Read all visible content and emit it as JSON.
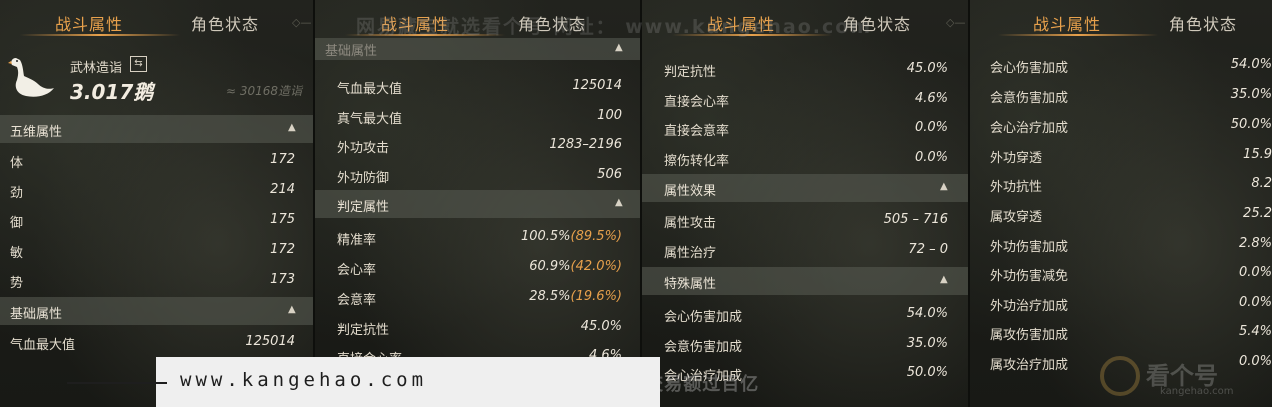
{
  "tabs": {
    "combat": "战斗属性",
    "status": "角色状态"
  },
  "panel1": {
    "character": {
      "name": "武林造诣",
      "value": "3.017鹅",
      "approx": "≈ 30168造诣"
    },
    "five_dim": {
      "title": "五维属性",
      "rows": [
        {
          "label": "体",
          "value": "172"
        },
        {
          "label": "劲",
          "value": "214"
        },
        {
          "label": "御",
          "value": "175"
        },
        {
          "label": "敏",
          "value": "172"
        },
        {
          "label": "势",
          "value": "173"
        }
      ]
    },
    "basic": {
      "title": "基础属性",
      "rows": [
        {
          "label": "气血最大值",
          "value": "125014"
        }
      ]
    }
  },
  "panel2": {
    "top_header_partial": "基础属性",
    "basic_rows": [
      {
        "label": "气血最大值",
        "value": "125014"
      },
      {
        "label": "真气最大值",
        "value": "100"
      },
      {
        "label": "外功攻击",
        "value": "1283–2196"
      },
      {
        "label": "外功防御",
        "value": "506"
      }
    ],
    "judge": {
      "title": "判定属性",
      "rows": [
        {
          "label": "精准率",
          "value": "100.5%",
          "paren": "(89.5%)"
        },
        {
          "label": "会心率",
          "value": "60.9%",
          "paren": "(42.0%)"
        },
        {
          "label": "会意率",
          "value": "28.5%",
          "paren": "(19.6%)"
        },
        {
          "label": "判定抗性",
          "value": "45.0%",
          "paren": ""
        },
        {
          "label": "直接会心率",
          "value": "4.6%",
          "paren": ""
        }
      ]
    }
  },
  "panel3": {
    "rows_top": [
      {
        "label": "判定抗性",
        "value": "45.0%"
      },
      {
        "label": "直接会心率",
        "value": "4.6%"
      },
      {
        "label": "直接会意率",
        "value": "0.0%"
      },
      {
        "label": "擦伤转化率",
        "value": "0.0%"
      }
    ],
    "effect": {
      "title": "属性效果",
      "rows": [
        {
          "label": "属性攻击",
          "value": "505 – 716"
        },
        {
          "label": "属性治疗",
          "value": "72 – 0"
        }
      ]
    },
    "special": {
      "title": "特殊属性",
      "rows": [
        {
          "label": "会心伤害加成",
          "value": "54.0%"
        },
        {
          "label": "会意伤害加成",
          "value": "35.0%"
        },
        {
          "label": "会心治疗加成",
          "value": "50.0%"
        }
      ]
    }
  },
  "panel4": {
    "rows": [
      {
        "label": "会心伤害加成",
        "value": "54.0%"
      },
      {
        "label": "会意伤害加成",
        "value": "35.0%"
      },
      {
        "label": "会心治疗加成",
        "value": "50.0%"
      },
      {
        "label": "外功穿透",
        "value": "15.9"
      },
      {
        "label": "外功抗性",
        "value": "8.2"
      },
      {
        "label": "属攻穿透",
        "value": "25.2"
      },
      {
        "label": "外功伤害加成",
        "value": "2.8%"
      },
      {
        "label": "外功伤害减免",
        "value": "0.0%"
      },
      {
        "label": "外功治疗加成",
        "value": "0.0%"
      },
      {
        "label": "属攻伤害加成",
        "value": "5.4%"
      },
      {
        "label": "属攻治疗加成",
        "value": "0.0%"
      }
    ]
  },
  "watermarks": {
    "top": "网易藏宝就选看个号 网址： www.kangehao.com",
    "footer_url": "www.kangehao.com",
    "footer_slogan": "看个号专业网易游戏八年 年交易额过百亿",
    "logo_text": "看个号",
    "logo_sub": "kangehao.com"
  }
}
